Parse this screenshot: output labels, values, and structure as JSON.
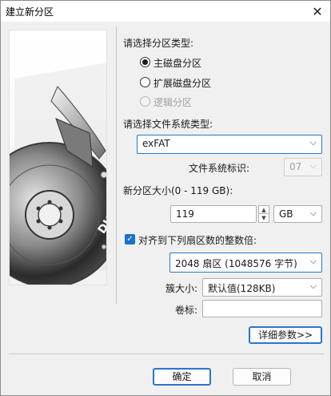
{
  "window": {
    "title": "建立新分区",
    "close_glyph": "✕"
  },
  "image": {
    "logo_text": "DISKGENIUS"
  },
  "partition_type": {
    "heading": "请选择分区类型:",
    "options": [
      {
        "label": "主磁盘分区",
        "selected": true,
        "enabled": true
      },
      {
        "label": "扩展磁盘分区",
        "selected": false,
        "enabled": true
      },
      {
        "label": "逻辑分区",
        "selected": false,
        "enabled": false
      }
    ]
  },
  "filesystem": {
    "heading": "请选择文件系统类型:",
    "selected": "exFAT",
    "id_label": "文件系统标识:",
    "id_value": "07"
  },
  "size": {
    "label": "新分区大小(0 - 119 GB):",
    "value": "119",
    "unit": "GB"
  },
  "align": {
    "checked": true,
    "label": "对齐到下列扇区数的整数倍:",
    "value": "2048 扇区 (1048576 字节)"
  },
  "cluster": {
    "label": "簇大小:",
    "value": "默认值(128KB)"
  },
  "volume": {
    "label": "卷标:",
    "value": ""
  },
  "buttons": {
    "details": "详细参数>>",
    "ok": "确定",
    "cancel": "取消"
  },
  "colors": {
    "accent": "#2a77c9",
    "checkbox": "#1a73c9"
  }
}
